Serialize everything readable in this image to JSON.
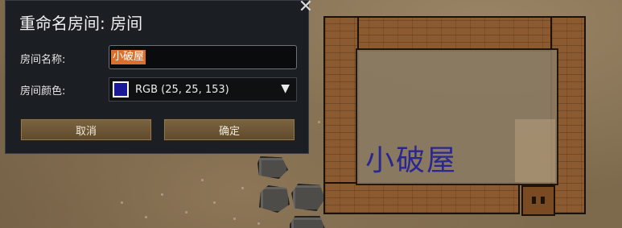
{
  "dialog": {
    "title": "重命名房间: 房间",
    "name_label": "房间名称:",
    "name_value": "小破屋",
    "color_label": "房间颜色:",
    "color_value": "RGB (25, 25, 153)",
    "color_hex": "#191999",
    "cancel_label": "取消",
    "confirm_label": "确定",
    "close_icon": "close-icon"
  },
  "map": {
    "room_label": "小破屋",
    "room_label_color": "#2a2790"
  }
}
